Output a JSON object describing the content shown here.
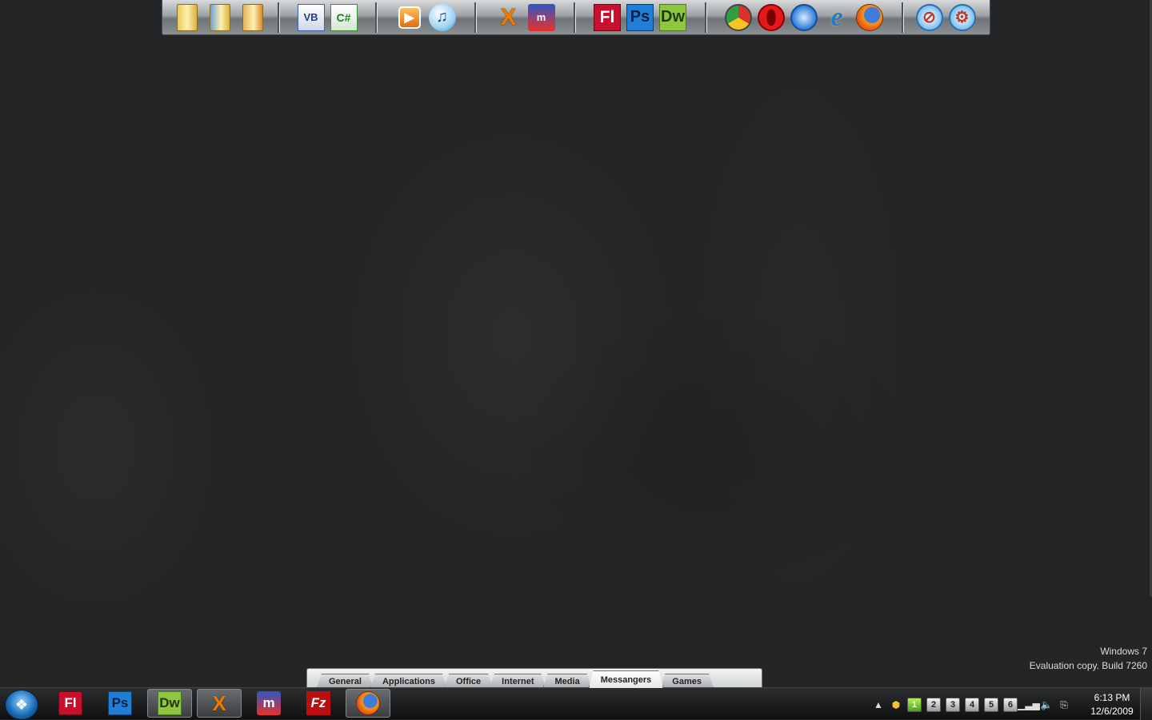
{
  "dock": {
    "groups": [
      {
        "name": "folders",
        "icons": [
          "folder-icon",
          "folder-documents-icon",
          "folder-music-icon"
        ]
      },
      {
        "name": "development",
        "icons": [
          "visual-basic-icon",
          "visual-csharp-icon"
        ],
        "labels": {
          "vb": "VB",
          "cs": "C#"
        }
      },
      {
        "name": "media",
        "icons": [
          "windows-media-player-icon",
          "itunes-icon"
        ],
        "labels": {
          "itunes": "♫"
        }
      },
      {
        "name": "messengers",
        "icons": [
          "xchat-icon",
          "mirc-icon"
        ],
        "labels": {
          "xchat": "X",
          "mirc": "m"
        }
      },
      {
        "name": "adobe",
        "icons": [
          "flash-icon",
          "photoshop-icon",
          "dreamweaver-icon"
        ],
        "labels": {
          "fl": "Fl",
          "ps": "Ps",
          "dw": "Dw"
        }
      },
      {
        "name": "browsers",
        "icons": [
          "chrome-icon",
          "opera-icon",
          "safari-icon",
          "internet-explorer-icon",
          "firefox-icon"
        ],
        "labels": {
          "ie": "e"
        }
      },
      {
        "name": "tools",
        "icons": [
          "network-disconnect-icon",
          "network-settings-icon"
        ]
      }
    ]
  },
  "tabs": [
    {
      "label": "General",
      "active": false
    },
    {
      "label": "Applications",
      "active": false
    },
    {
      "label": "Office",
      "active": false
    },
    {
      "label": "Internet",
      "active": false
    },
    {
      "label": "Media",
      "active": false
    },
    {
      "label": "Messangers",
      "active": true
    },
    {
      "label": "Games",
      "active": false
    }
  ],
  "watermark": {
    "line1": "Windows 7",
    "line2": "Evaluation copy. Build 7260"
  },
  "taskbar": {
    "pinned": [
      {
        "icon": "flash-icon",
        "label": "Fl"
      },
      {
        "icon": "photoshop-icon",
        "label": "Ps"
      },
      {
        "icon": "dreamweaver-icon",
        "label": "Dw"
      },
      {
        "icon": "xchat-icon",
        "label": "X"
      },
      {
        "icon": "mirc-icon",
        "label": "m"
      },
      {
        "icon": "filezilla-icon",
        "label": "Fz"
      },
      {
        "icon": "firefox-icon",
        "label": ""
      }
    ],
    "virtual_desktops": [
      "1",
      "2",
      "3",
      "4",
      "5",
      "6"
    ],
    "active_desktop": "1",
    "clock": {
      "time": "6:13 PM",
      "date": "12/6/2009"
    }
  },
  "colors": {
    "desktop_bg": "#232526",
    "taskbar_bg": "#0f1011",
    "tab_active": "#ffffff"
  }
}
